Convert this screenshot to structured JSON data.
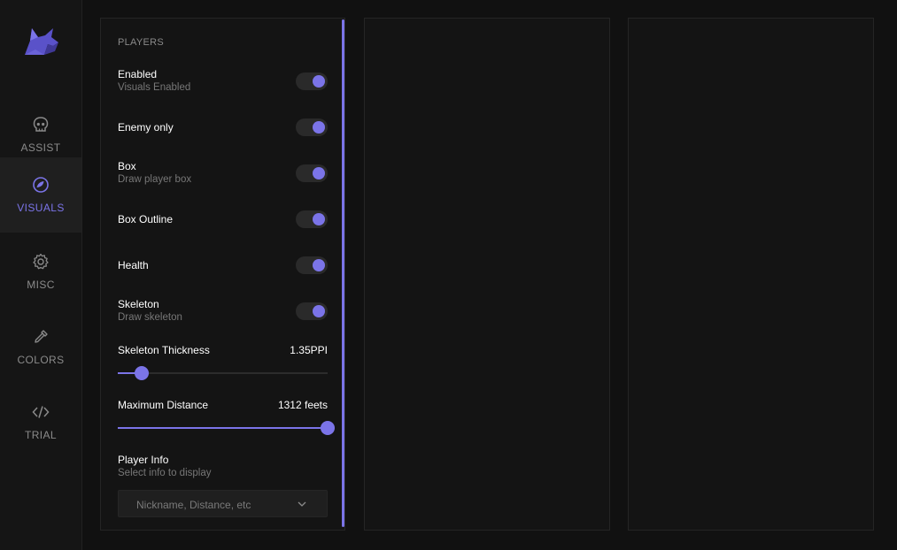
{
  "sidebar": {
    "items": [
      {
        "label": "ASSIST",
        "icon": "skull-icon"
      },
      {
        "label": "VISUALS",
        "icon": "visual-icon"
      },
      {
        "label": "MISC",
        "icon": "gear-icon"
      },
      {
        "label": "COLORS",
        "icon": "eyedropper-icon"
      },
      {
        "label": "TRIAL",
        "icon": "code-icon"
      }
    ],
    "active_item": "VISUALS"
  },
  "players": {
    "title": "PLAYERS",
    "toggles": [
      {
        "label": "Enabled",
        "sub": "Visuals Enabled",
        "on": true
      },
      {
        "label": "Enemy only",
        "sub": "",
        "on": true
      },
      {
        "label": "Box",
        "sub": "Draw player box",
        "on": true
      },
      {
        "label": "Box Outline",
        "sub": "",
        "on": true
      },
      {
        "label": "Health",
        "sub": "",
        "on": true
      },
      {
        "label": "Skeleton",
        "sub": "Draw skeleton",
        "on": true
      }
    ],
    "skeleton_thickness": {
      "label": "Skeleton Thickness",
      "value_text": "1.35PPI",
      "fraction": 0.115
    },
    "max_distance": {
      "label": "Maximum Distance",
      "value_text": "1312 feets",
      "fraction": 1.0
    },
    "player_info": {
      "label": "Player Info",
      "sub": "Select info to display",
      "placeholder": "Nickname, Distance, etc"
    }
  },
  "colors": {
    "accent": "#7b74e8",
    "background": "#111111",
    "panel": "#141414"
  }
}
